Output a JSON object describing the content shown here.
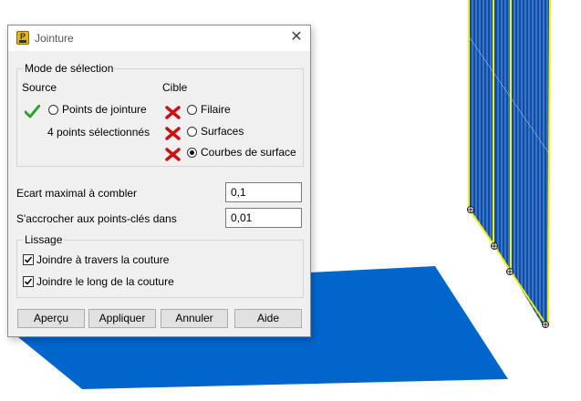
{
  "dialog": {
    "title": "Jointure",
    "close_icon": "close-icon",
    "app_icon": "app-logo-icon",
    "selection_mode": {
      "label": "Mode de sélection",
      "source": {
        "label": "Source",
        "option": "Points de jointure",
        "selected": false,
        "status_icon": "green-check-icon",
        "status_text": "4 points sélectionnés"
      },
      "target": {
        "label": "Cible",
        "options": [
          {
            "label": "Filaire",
            "selected": false,
            "status_icon": "red-x-icon"
          },
          {
            "label": "Surfaces",
            "selected": false,
            "status_icon": "red-x-icon"
          },
          {
            "label": "Courbes de surface",
            "selected": true,
            "status_icon": "red-x-icon"
          }
        ]
      }
    },
    "max_gap": {
      "label": "Ecart maximal à combler",
      "value": "0,1"
    },
    "snap": {
      "label": "S'accrocher aux points-clés dans",
      "value": "0,01"
    },
    "smoothing": {
      "label": "Lissage",
      "options": [
        {
          "label": "Joindre à travers la couture",
          "checked": true
        },
        {
          "label": "Joindre le long de la couture",
          "checked": true
        }
      ]
    },
    "buttons": {
      "preview": "Aperçu",
      "apply": "Appliquer",
      "cancel": "Annuler",
      "help": "Aide"
    }
  },
  "colors": {
    "surface_blue": "#0066cc",
    "edge_yellow": "#f4f000",
    "check_green": "#2aa52a",
    "x_red": "#cc1111"
  }
}
